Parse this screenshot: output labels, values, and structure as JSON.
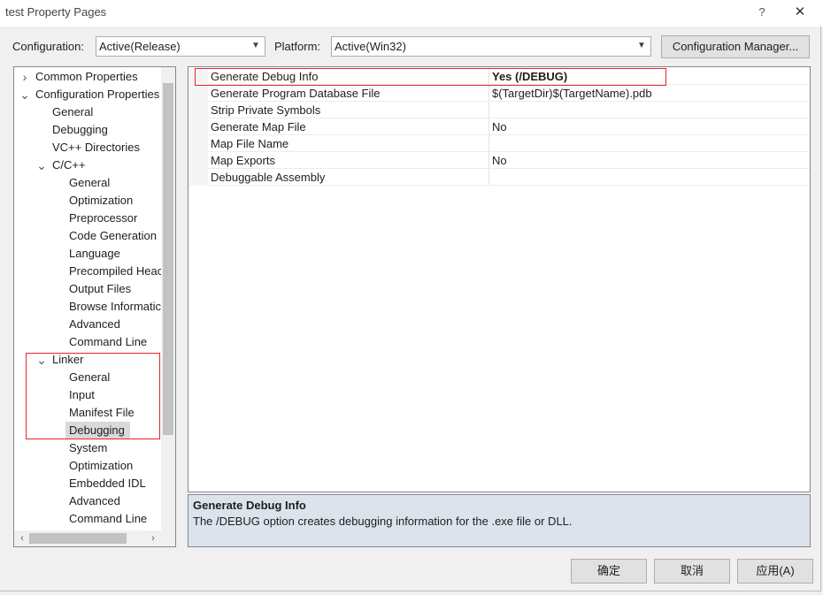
{
  "window": {
    "title": "test Property Pages",
    "help_glyph": "?",
    "close_glyph": "✕"
  },
  "config_row": {
    "configuration_label": "Configuration:",
    "configuration_value": "Active(Release)",
    "platform_label": "Platform:",
    "platform_value": "Active(Win32)",
    "manager_button": "Configuration Manager..."
  },
  "tree": [
    {
      "label": "Common Properties",
      "indent": 0,
      "expander": ">"
    },
    {
      "label": "Configuration Properties",
      "indent": 0,
      "expander": "v"
    },
    {
      "label": "General",
      "indent": 1,
      "expander": ""
    },
    {
      "label": "Debugging",
      "indent": 1,
      "expander": ""
    },
    {
      "label": "VC++ Directories",
      "indent": 1,
      "expander": ""
    },
    {
      "label": "C/C++",
      "indent": 1,
      "expander": "v"
    },
    {
      "label": "General",
      "indent": 2,
      "expander": ""
    },
    {
      "label": "Optimization",
      "indent": 2,
      "expander": ""
    },
    {
      "label": "Preprocessor",
      "indent": 2,
      "expander": ""
    },
    {
      "label": "Code Generation",
      "indent": 2,
      "expander": ""
    },
    {
      "label": "Language",
      "indent": 2,
      "expander": ""
    },
    {
      "label": "Precompiled Heac",
      "indent": 2,
      "expander": ""
    },
    {
      "label": "Output Files",
      "indent": 2,
      "expander": ""
    },
    {
      "label": "Browse Informatic",
      "indent": 2,
      "expander": ""
    },
    {
      "label": "Advanced",
      "indent": 2,
      "expander": ""
    },
    {
      "label": "Command Line",
      "indent": 2,
      "expander": ""
    },
    {
      "label": "Linker",
      "indent": 1,
      "expander": "v"
    },
    {
      "label": "General",
      "indent": 2,
      "expander": ""
    },
    {
      "label": "Input",
      "indent": 2,
      "expander": ""
    },
    {
      "label": "Manifest File",
      "indent": 2,
      "expander": ""
    },
    {
      "label": "Debugging",
      "indent": 2,
      "expander": "",
      "selected": true
    },
    {
      "label": "System",
      "indent": 2,
      "expander": ""
    },
    {
      "label": "Optimization",
      "indent": 2,
      "expander": ""
    },
    {
      "label": "Embedded IDL",
      "indent": 2,
      "expander": ""
    },
    {
      "label": "Advanced",
      "indent": 2,
      "expander": ""
    },
    {
      "label": "Command Line",
      "indent": 2,
      "expander": ""
    }
  ],
  "properties": [
    {
      "name": "Generate Debug Info",
      "value": "Yes (/DEBUG)",
      "bold": true
    },
    {
      "name": "Generate Program Database File",
      "value": "$(TargetDir)$(TargetName).pdb"
    },
    {
      "name": "Strip Private Symbols",
      "value": ""
    },
    {
      "name": "Generate Map File",
      "value": "No"
    },
    {
      "name": "Map File Name",
      "value": ""
    },
    {
      "name": "Map Exports",
      "value": "No"
    },
    {
      "name": "Debuggable Assembly",
      "value": ""
    }
  ],
  "description": {
    "title": "Generate Debug Info",
    "text": "The /DEBUG option creates debugging information for the .exe file or DLL."
  },
  "buttons": {
    "ok": "确定",
    "cancel": "取消",
    "apply": "应用(A)"
  },
  "colors": {
    "highlight_box": "#e8242a",
    "description_bg": "#dde3ec"
  }
}
